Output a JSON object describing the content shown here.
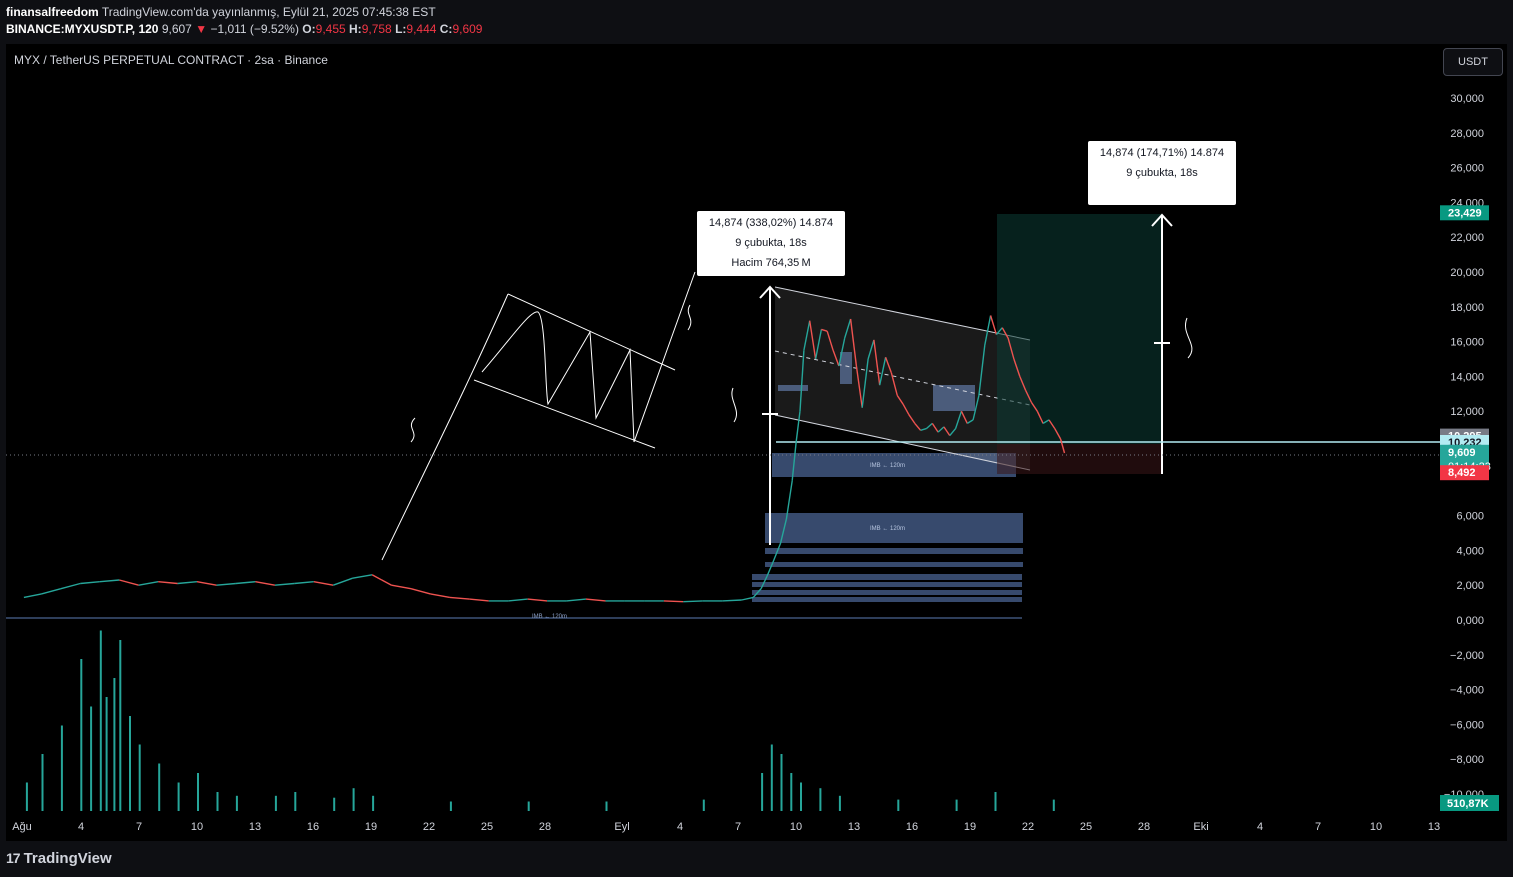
{
  "header": {
    "author": "finansalfreedom",
    "published": "TradingView.com'da yayınlanmış, Eylül 21, 2025 07:45:38 EST",
    "symbol": "BINANCE:MYXUSDT.P, 120",
    "last": "9,607",
    "change_arrow": "▼",
    "change": "−1,011 (−9.52%)",
    "o_label": "O:",
    "o": "9,455",
    "h_label": "H:",
    "h": "9,758",
    "l_label": "L:",
    "l": "9,444",
    "c_label": "C:",
    "c": "9,609"
  },
  "chart_title": "MYX / TetherUS PERPETUAL CONTRACT · 2sa · Binance",
  "unit_button": "USDT",
  "brand": "TradingView",
  "brand_mark": "17",
  "colors": {
    "up": "#26a69a",
    "down": "#ef5350",
    "bg": "#000000",
    "hline": "#b2ebf2",
    "target": "#089981",
    "stop": "#f23645"
  },
  "chart_data": {
    "type": "candlestick",
    "y_ticks": [
      "30,000",
      "28,000",
      "26,000",
      "24,000",
      "22,000",
      "20,000",
      "18,000",
      "16,000",
      "14,000",
      "12,000",
      "6,000",
      "4,000",
      "2,000",
      "0,000",
      "−2,000",
      "−4,000",
      "−6,000",
      "−8,000",
      "−10,000"
    ],
    "y_tick_values": [
      30,
      28,
      26,
      24,
      22,
      20,
      18,
      16,
      14,
      12,
      6,
      4,
      2,
      0,
      -2,
      -4,
      -6,
      -8,
      -10
    ],
    "x_ticks": [
      "Ağu",
      "4",
      "7",
      "10",
      "13",
      "16",
      "19",
      "22",
      "25",
      "28",
      "Eyl",
      "4",
      "7",
      "10",
      "13",
      "16",
      "19",
      "22",
      "25",
      "28",
      "Eki",
      "4",
      "7",
      "10",
      "13"
    ],
    "price_labels": [
      {
        "text": "23,429",
        "value": 23.429,
        "color": "#089981"
      },
      {
        "text": "10,295",
        "value": 10.6,
        "color": "#787b86"
      },
      {
        "text": "10,232",
        "value": 10.232,
        "color": "#b2ebf2"
      },
      {
        "text": "9,609",
        "sub": "01:14:23",
        "value": 9.609,
        "color": "#26a69a"
      },
      {
        "text": "8,492",
        "value": 8.492,
        "color": "#f23645"
      }
    ],
    "volume_label": "510,87K",
    "annotations": [
      {
        "lines": [
          "14,874 (338,02%) 14.874",
          "9 çubukta, 18s",
          "Hacim 764,35 M"
        ]
      },
      {
        "lines": [
          "14,874 (174,71%) 14.874",
          "9 çubukta, 18s"
        ]
      }
    ],
    "imb_label": "IMB ← 120m",
    "price_path": [
      [
        0.1,
        1.3
      ],
      [
        1.0,
        1.5
      ],
      [
        2.0,
        1.8
      ],
      [
        3.0,
        2.1
      ],
      [
        4.0,
        2.2
      ],
      [
        5.0,
        2.3
      ],
      [
        6.0,
        2.0
      ],
      [
        7.0,
        2.2
      ],
      [
        8.0,
        2.1
      ],
      [
        9.0,
        2.2
      ],
      [
        10.0,
        2.0
      ],
      [
        11.0,
        2.1
      ],
      [
        12.0,
        2.2
      ],
      [
        13.0,
        2.0
      ],
      [
        14.0,
        2.1
      ],
      [
        15.0,
        2.2
      ],
      [
        16.0,
        2.0
      ],
      [
        17.0,
        2.4
      ],
      [
        18.0,
        2.6
      ],
      [
        18.5,
        2.3
      ],
      [
        19.0,
        2.0
      ],
      [
        20.0,
        1.8
      ],
      [
        21.0,
        1.5
      ],
      [
        22.0,
        1.3
      ],
      [
        23.0,
        1.2
      ],
      [
        24.0,
        1.1
      ],
      [
        25.0,
        1.1
      ],
      [
        26.0,
        1.2
      ],
      [
        27.0,
        1.1
      ],
      [
        28.0,
        1.1
      ],
      [
        29.0,
        1.2
      ],
      [
        30.0,
        1.1
      ],
      [
        31.0,
        1.1
      ],
      [
        32.0,
        1.1
      ],
      [
        33.0,
        1.1
      ],
      [
        34.0,
        1.05
      ],
      [
        35.0,
        1.1
      ],
      [
        36.0,
        1.1
      ],
      [
        37.0,
        1.15
      ],
      [
        37.6,
        1.3
      ],
      [
        38.0,
        1.8
      ],
      [
        38.3,
        2.5
      ],
      [
        38.6,
        3.3
      ],
      [
        39.0,
        4.4
      ],
      [
        39.3,
        5.8
      ],
      [
        39.6,
        8.0
      ],
      [
        39.8,
        10.2
      ],
      [
        40.0,
        12.0
      ],
      [
        40.2,
        15.5
      ],
      [
        40.5,
        17.2
      ],
      [
        40.8,
        15.0
      ],
      [
        41.1,
        16.7
      ],
      [
        41.4,
        16.6
      ],
      [
        41.7,
        15.5
      ],
      [
        42.0,
        14.6
      ],
      [
        42.3,
        16.2
      ],
      [
        42.6,
        17.3
      ],
      [
        42.9,
        14.6
      ],
      [
        43.2,
        12.2
      ],
      [
        43.5,
        15.0
      ],
      [
        43.8,
        16.1
      ],
      [
        44.1,
        13.5
      ],
      [
        44.4,
        15.1
      ],
      [
        44.7,
        14.2
      ],
      [
        45.0,
        12.9
      ],
      [
        45.3,
        12.4
      ],
      [
        45.6,
        11.8
      ],
      [
        45.9,
        11.3
      ],
      [
        46.2,
        10.9
      ],
      [
        46.5,
        11.0
      ],
      [
        46.8,
        11.3
      ],
      [
        47.1,
        10.8
      ],
      [
        47.4,
        11.1
      ],
      [
        47.7,
        10.6
      ],
      [
        48.0,
        11.0
      ],
      [
        48.3,
        12.0
      ],
      [
        48.6,
        11.3
      ],
      [
        48.9,
        11.5
      ],
      [
        49.2,
        12.9
      ],
      [
        49.5,
        15.8
      ],
      [
        49.8,
        17.5
      ],
      [
        50.1,
        16.4
      ],
      [
        50.4,
        16.8
      ],
      [
        50.7,
        16.2
      ],
      [
        51.0,
        15.0
      ],
      [
        51.3,
        14.0
      ],
      [
        51.6,
        13.2
      ],
      [
        51.9,
        12.5
      ],
      [
        52.2,
        12.0
      ],
      [
        52.5,
        11.3
      ],
      [
        52.8,
        11.5
      ],
      [
        53.1,
        11.0
      ],
      [
        53.4,
        10.4
      ],
      [
        53.6,
        9.6
      ]
    ],
    "volume": [
      [
        0.2,
        0.15
      ],
      [
        1.0,
        0.3
      ],
      [
        2.0,
        0.45
      ],
      [
        3.0,
        0.8
      ],
      [
        3.5,
        0.55
      ],
      [
        4.0,
        0.95
      ],
      [
        4.3,
        0.6
      ],
      [
        4.7,
        0.7
      ],
      [
        5.0,
        0.9
      ],
      [
        5.5,
        0.5
      ],
      [
        6.0,
        0.35
      ],
      [
        7.0,
        0.25
      ],
      [
        8.0,
        0.15
      ],
      [
        9.0,
        0.2
      ],
      [
        10.0,
        0.1
      ],
      [
        11.0,
        0.08
      ],
      [
        13.0,
        0.08
      ],
      [
        14.0,
        0.1
      ],
      [
        16.0,
        0.07
      ],
      [
        17.0,
        0.12
      ],
      [
        18.0,
        0.08
      ],
      [
        22.0,
        0.05
      ],
      [
        26.0,
        0.05
      ],
      [
        30.0,
        0.05
      ],
      [
        35.0,
        0.06
      ],
      [
        38.0,
        0.2
      ],
      [
        38.5,
        0.35
      ],
      [
        39.0,
        0.3
      ],
      [
        39.5,
        0.2
      ],
      [
        40.0,
        0.15
      ],
      [
        41.0,
        0.12
      ],
      [
        42.0,
        0.08
      ],
      [
        45.0,
        0.06
      ],
      [
        48.0,
        0.06
      ],
      [
        50.0,
        0.1
      ],
      [
        53.0,
        0.06
      ]
    ]
  }
}
